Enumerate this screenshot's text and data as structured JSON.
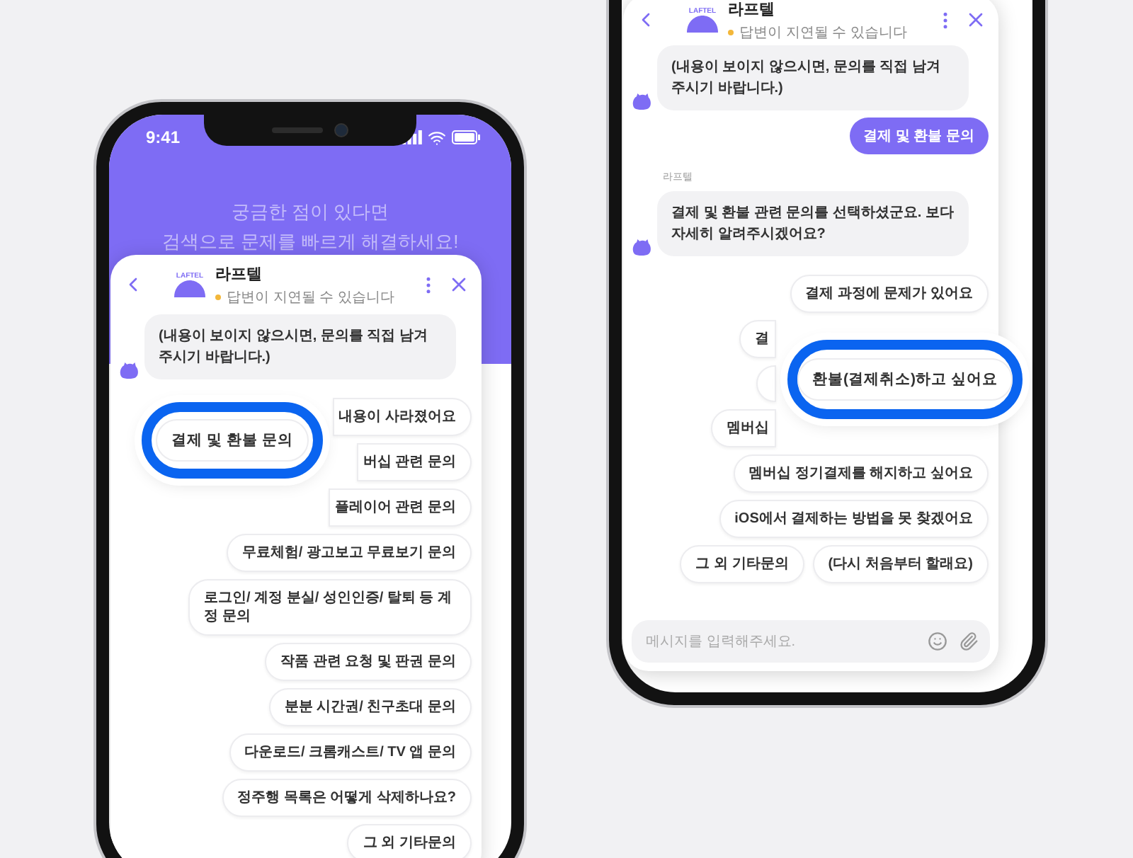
{
  "left_phone": {
    "status_bar": {
      "time": "9:41"
    },
    "banner": {
      "lines": [
        "궁금한 점이 있다면",
        "검색으로 문제를 빠르게 해결하세요!"
      ]
    },
    "chat": {
      "header": {
        "logo_text": "LAFTEL",
        "name": "라프텔",
        "status": "답변이 지연될 수 있습니다"
      },
      "messages": [
        {
          "kind": "bot",
          "text": "(내용이 보이지 않으시면, 문의를 직접 남겨 주시기 바랍니다.)"
        }
      ],
      "option_rows": [
        {
          "options": [
            {
              "kind": "covered_left",
              "label": "내용이 사라졌어요"
            }
          ]
        },
        {
          "options": [
            {
              "kind": "covered_left",
              "label": "버십 관련 문의"
            }
          ]
        },
        {
          "options": [
            {
              "kind": "covered_left",
              "label": "플레이어 관련 문의"
            }
          ]
        },
        {
          "options": [
            {
              "kind": "plain",
              "label": "무료체험/ 광고보고 무료보기 문의"
            }
          ]
        },
        {
          "options": [
            {
              "kind": "plain",
              "label": "로그인/ 계정 분실/ 성인인증/ 탈퇴 등 계정 문의"
            }
          ]
        },
        {
          "options": [
            {
              "kind": "plain",
              "label": "작품 관련 요청 및 판권 문의"
            }
          ]
        },
        {
          "options": [
            {
              "kind": "plain",
              "label": "분분 시간권/ 친구초대 문의"
            }
          ]
        },
        {
          "options": [
            {
              "kind": "plain",
              "label": "다운로드/ 크롬캐스트/ TV 앱 문의"
            }
          ]
        },
        {
          "options": [
            {
              "kind": "plain",
              "label": "정주행 목록은 어떻게 삭제하나요?"
            }
          ]
        },
        {
          "options": [
            {
              "kind": "plain",
              "label": "그 외 기타문의"
            }
          ]
        }
      ]
    },
    "highlight": {
      "label": "결제 및 환불 문의"
    }
  },
  "right_phone": {
    "chat": {
      "header": {
        "logo_text": "LAFTEL",
        "name": "라프텔",
        "status": "답변이 지연될 수 있습니다"
      },
      "messages": [
        {
          "kind": "bot",
          "text": "(내용이 보이지 않으시면, 문의를 직접 남겨 주시기 바랍니다.)"
        },
        {
          "kind": "user",
          "text": "결제 및 환불 문의"
        },
        {
          "kind": "sender",
          "text": "라프텔"
        },
        {
          "kind": "bot",
          "text": "결제 및 환불 관련 문의를 선택하셨군요. 보다 자세히 알려주시겠어요?"
        }
      ],
      "option_rows": [
        {
          "options": [
            {
              "kind": "plain",
              "label": "결제 과정에 문제가 있어요"
            }
          ]
        },
        {
          "options": [
            {
              "kind": "covered_right",
              "label": "결"
            }
          ]
        },
        {
          "options": [
            {
              "kind": "covered"
            }
          ]
        },
        {
          "options": [
            {
              "kind": "covered_right",
              "label": "멤버십"
            }
          ]
        },
        {
          "options": [
            {
              "kind": "plain",
              "label": "멤버십 정기결제를 해지하고 싶어요"
            }
          ]
        },
        {
          "options": [
            {
              "kind": "plain",
              "label": "iOS에서 결제하는 방법을 못 찾겠어요"
            }
          ]
        },
        {
          "options": [
            {
              "kind": "plain",
              "label": "그 외 기타문의"
            },
            {
              "kind": "plain",
              "label": "(다시 처음부터 할래요)"
            }
          ]
        }
      ],
      "input": {
        "placeholder": "메시지를 입력해주세요."
      }
    },
    "highlight": {
      "label": "환불(결제취소)하고 싶어요"
    }
  }
}
